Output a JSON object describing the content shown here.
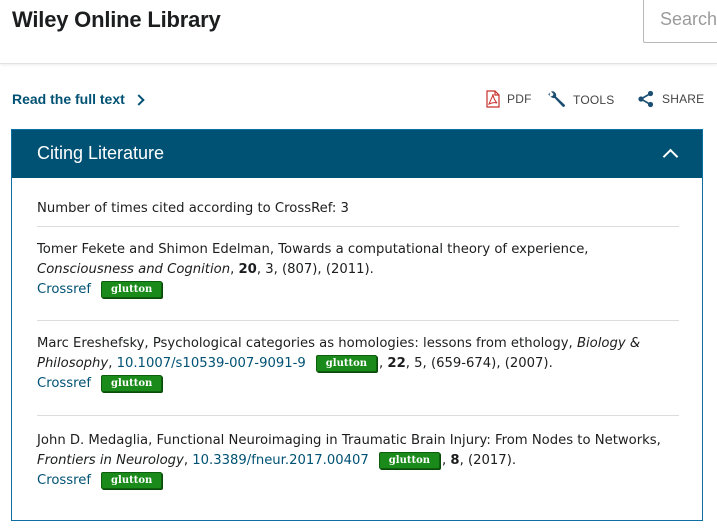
{
  "header": {
    "logo": "Wiley Online Library",
    "search_placeholder": "Search"
  },
  "toolbar": {
    "read_full_text": "Read the full text",
    "pdf": "PDF",
    "tools": "TOOLS",
    "share": "SHARE"
  },
  "panel": {
    "title": "Citing Literature",
    "cited_count_text": "Number of times cited according to CrossRef: 3",
    "citations": [
      {
        "line1": "Tomer Fekete and Shimon Edelman, Towards a computational theory of experience,",
        "journal": "Consciousness and Cognition",
        "volume": "20",
        "rest": ", 3, (807), (2011).",
        "crossref": "Crossref",
        "badge": "glutton"
      },
      {
        "line1": "Marc Ereshefsky, Psychological categories as homologies: lessons from ethology, ",
        "journal_part1": "Biology &",
        "journal_part2": "Philosophy",
        "doi": "10.1007/s10539-007-9091-9",
        "badge_inline": "glutton",
        "volume": "22",
        "rest": ", 5, (659-674), (2007).",
        "crossref": "Crossref",
        "badge": "glutton"
      },
      {
        "line1": "John D. Medaglia, Functional Neuroimaging in Traumatic Brain Injury: From Nodes to Networks,",
        "journal": "Frontiers in Neurology",
        "doi": "10.3389/fneur.2017.00407",
        "badge_inline": "glutton",
        "volume": "8",
        "rest": ", (2017).",
        "crossref": "Crossref",
        "badge": "glutton"
      }
    ]
  }
}
